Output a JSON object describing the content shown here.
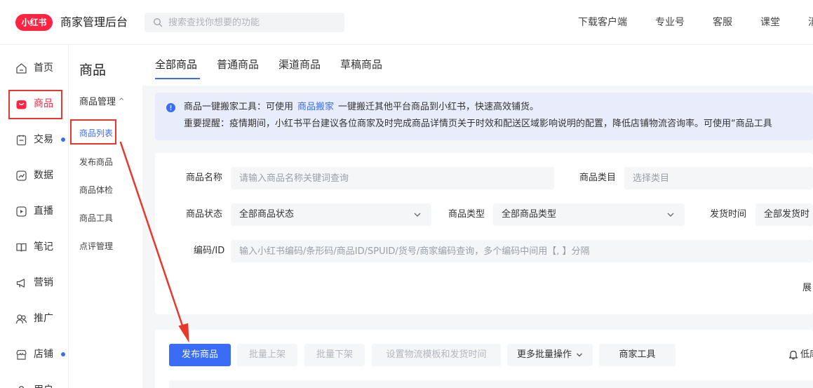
{
  "header": {
    "logo_text": "小红书",
    "app_title": "商家管理后台",
    "search_placeholder": "搜索查找你想要的功能",
    "nav": [
      "下载客户端",
      "专业号",
      "客服",
      "课堂",
      "消"
    ]
  },
  "sidebar": {
    "items": [
      {
        "label": "首页",
        "icon": "home-icon"
      },
      {
        "label": "商品",
        "icon": "bag-icon",
        "active": true
      },
      {
        "label": "交易",
        "icon": "clipboard-icon",
        "dot": true
      },
      {
        "label": "数据",
        "icon": "chart-icon"
      },
      {
        "label": "直播",
        "icon": "play-icon"
      },
      {
        "label": "笔记",
        "icon": "book-icon"
      },
      {
        "label": "营销",
        "icon": "megaphone-icon"
      },
      {
        "label": "推广",
        "icon": "users-icon"
      },
      {
        "label": "店铺",
        "icon": "store-icon",
        "dot": true
      },
      {
        "label": "用户",
        "icon": "user-icon"
      }
    ]
  },
  "subnav": {
    "title": "商品",
    "group": "商品管理",
    "items": [
      "商品列表",
      "发布商品",
      "商品体检",
      "商品工具",
      "点评管理"
    ]
  },
  "tabs": [
    "全部商品",
    "普通商品",
    "渠道商品",
    "草稿商品"
  ],
  "notice": {
    "line1_prefix": "商品一键搬家工具：可使用",
    "line1_link": "商品搬家",
    "line1_suffix": "一键搬迁其他平台商品到小红书，快速高效铺货。",
    "line2": "重要提醒：疫情期间，小红书平台建议各位商家及时完成商品详情页关于时效和配送区域影响说明的配置，降低店铺物流咨询率。可使用“商品工具"
  },
  "filters": {
    "name_label": "商品名称",
    "name_placeholder": "请输入商品名称关键词查询",
    "category_label": "商品类目",
    "category_placeholder": "选择类目",
    "status_label": "商品状态",
    "status_value": "全部商品状态",
    "type_label": "商品类型",
    "type_value": "全部商品类型",
    "ship_label": "发货时间",
    "ship_value": "全部发货时",
    "code_label": "编码/ID",
    "code_placeholder": "输入小红书编码/条形码/商品ID/SPUID/货号/商家编码查询，多个编码中间用【, 】分隔",
    "expand_label": "展"
  },
  "actions": {
    "publish": "发布商品",
    "batch_on": "批量上架",
    "batch_off": "批量下架",
    "set_logistics": "设置物流模板和发货时间",
    "more_batch": "更多批量操作",
    "merchant_tools": "商家工具",
    "low_stock": "低库"
  },
  "colors": {
    "brand": "#ff2442",
    "primary": "#3b6cf6",
    "annotation": "#e8382c"
  }
}
